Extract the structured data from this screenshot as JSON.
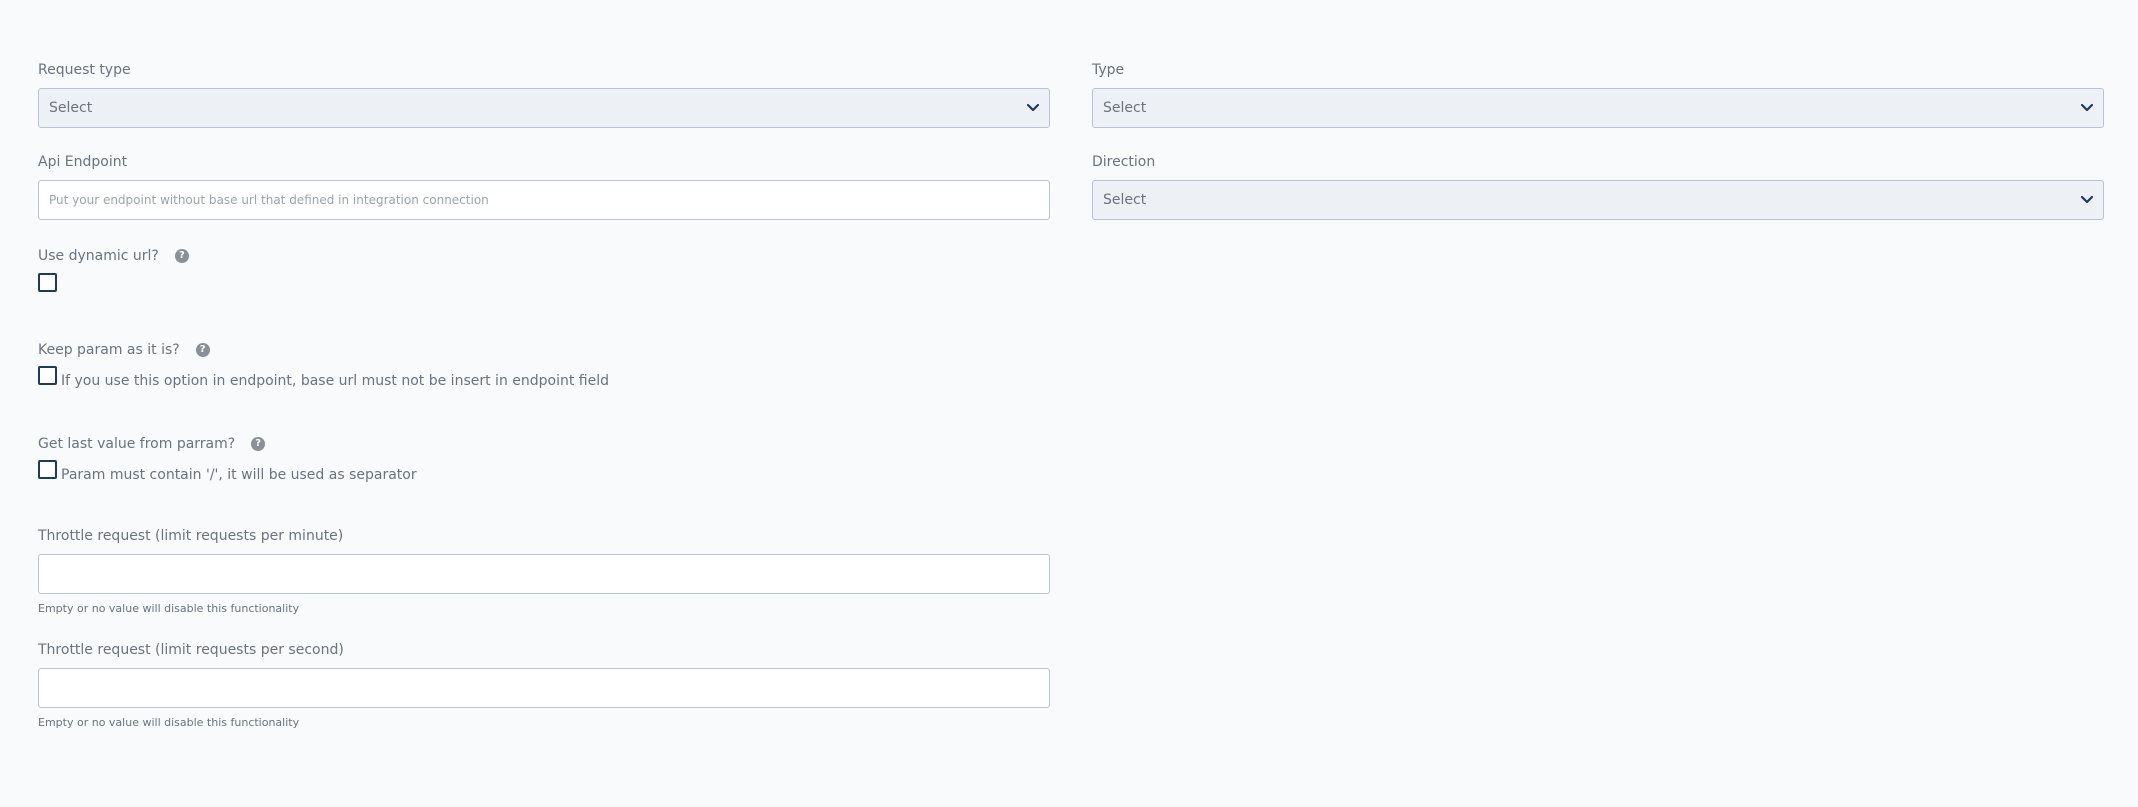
{
  "left": {
    "request_type": {
      "label": "Request type",
      "value": "Select"
    },
    "api_endpoint": {
      "label": "Api Endpoint",
      "placeholder": "Put your endpoint without base url that defined in integration connection",
      "value": ""
    },
    "dynamic_url": {
      "label": "Use dynamic url?",
      "help": "?",
      "checked": false
    },
    "keep_param": {
      "label": "Keep param as it is?",
      "help": "?",
      "checkbox_text": "If you use this option in endpoint, base url must not be insert in endpoint field",
      "checked": false
    },
    "last_value": {
      "label": "Get last value from parram?",
      "help": "?",
      "checkbox_text": "Param must contain '/', it will be used as separator",
      "checked": false
    },
    "throttle_minute": {
      "label": "Throttle request (limit requests per minute)",
      "value": "",
      "hint": "Empty or no value will disable this functionality"
    },
    "throttle_second": {
      "label": "Throttle request (limit requests per second)",
      "value": "",
      "hint": "Empty or no value will disable this functionality"
    }
  },
  "right": {
    "type": {
      "label": "Type",
      "value": "Select"
    },
    "direction": {
      "label": "Direction",
      "value": "Select"
    }
  },
  "icons": {
    "chevron": "chevron-down-icon",
    "help": "help-circle-icon"
  },
  "colors": {
    "page_bg": "#f8fafc",
    "select_bg": "#edf0f4",
    "border": "#b8c4d6",
    "checkbox_border": "#1e3a5f",
    "label": "#6b7280"
  }
}
